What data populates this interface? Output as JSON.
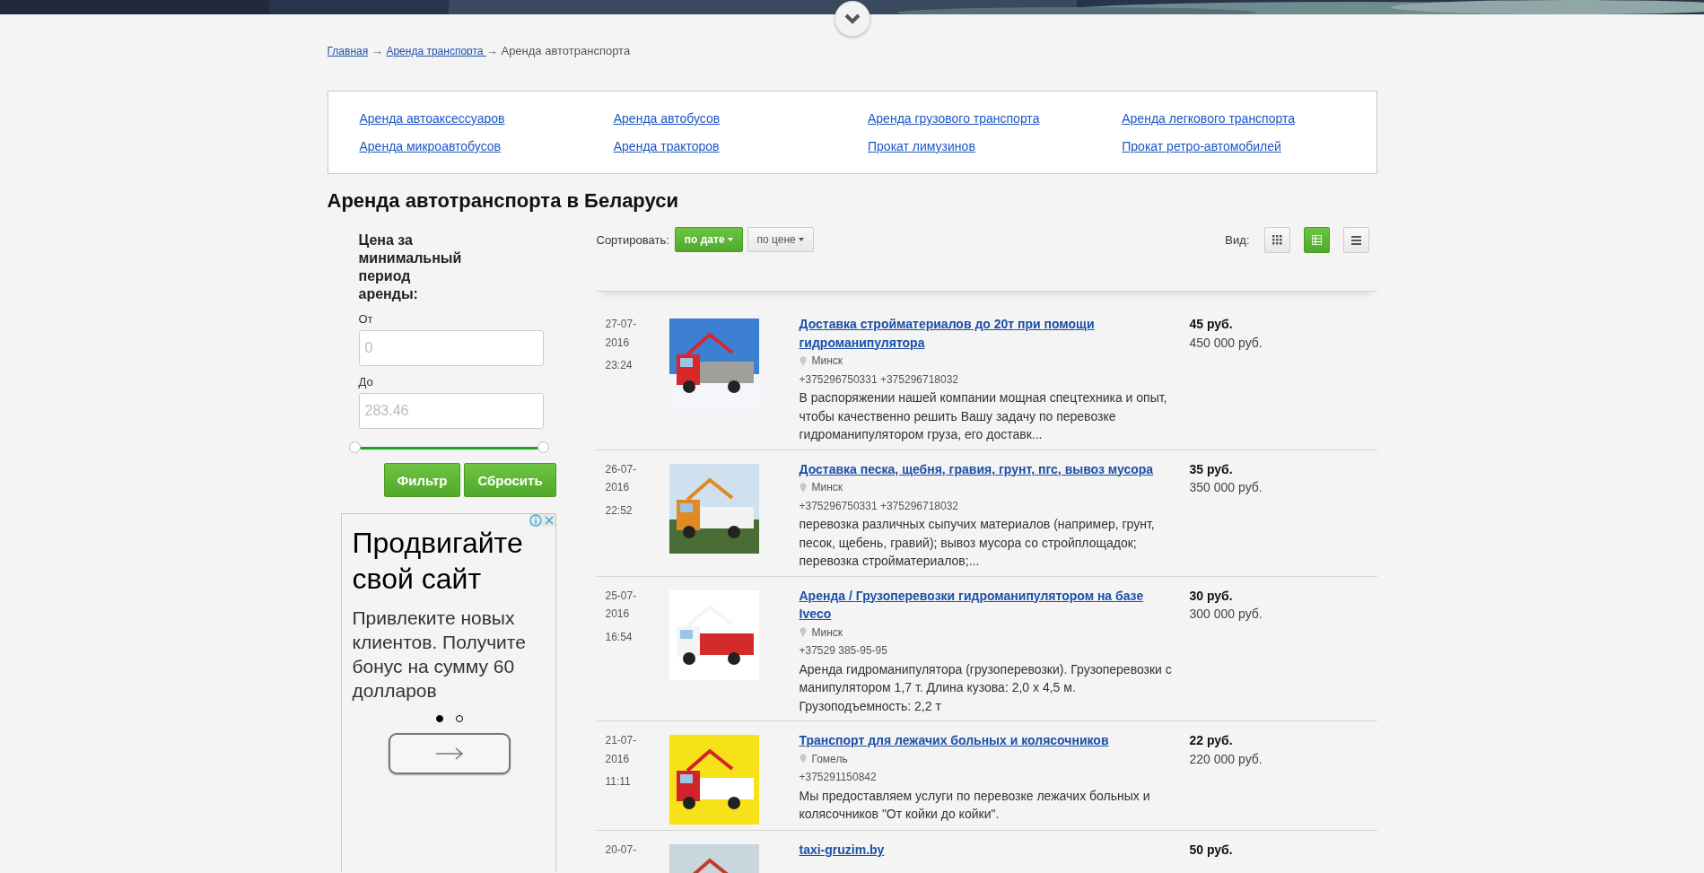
{
  "breadcrumb": [
    {
      "label": "Главная",
      "link": true
    },
    {
      "label": "Аренда транспорта ",
      "link": true
    },
    {
      "label": "Аренда автотранспорта",
      "link": false
    }
  ],
  "breadcrumb_separator": "→",
  "categories": [
    "Аренда автоаксессуаров",
    "Аренда автобусов",
    "Аренда грузового транспорта",
    "Аренда легкового транспорта",
    "Аренда микроавтобусов",
    "Аренда тракторов",
    "Прокат лимузинов",
    "Прокат ретро-автомобилей"
  ],
  "heading": "Аренда автотранспорта в Беларуси",
  "filter": {
    "title": "Цена за минимальный период аренды:",
    "from_label": "От",
    "from_placeholder": "0",
    "to_label": "До",
    "to_placeholder": "283.46",
    "slider": {
      "level": 1
    },
    "buttons": [
      "Фильтр",
      "Сбросить"
    ]
  },
  "ad": {
    "headline": "Продвигайте свой сайт",
    "body": "Привлеките новых клиентов. Получите бонус на сумму 60 долларов",
    "dots": [
      {
        "selected": true
      },
      {
        "selected": false
      }
    ]
  },
  "sort": {
    "label": "Сортировать:",
    "options": [
      {
        "label": "по дате",
        "selected": true
      },
      {
        "label": "по цене",
        "selected": false
      }
    ]
  },
  "view": {
    "label": "Вид:",
    "options": [
      {
        "kind": "grid",
        "selected": false
      },
      {
        "kind": "table",
        "selected": true
      },
      {
        "kind": "list",
        "selected": false
      }
    ]
  },
  "listings": [
    {
      "date": "27-07-2016",
      "time": "23:24",
      "title": "Доставка стройматериалов до 20т при помощи гидроманипулятора",
      "city": "Минск",
      "phone": "+375296750331 +375296718032",
      "description": "В распоряжении нашей компании мощная спецтехника и опыт, чтобы качественно решить Вашу задачу по перевозке гидроманипулятором груза, его доставк...",
      "price": "45 руб.",
      "price_old": "450 000 руб."
    },
    {
      "date": "26-07-2016",
      "time": "22:52",
      "title": "Доставка песка, щебня, гравия, грунт, пгс, вывоз мусора",
      "city": "Минск",
      "phone": "+375296750331 +375296718032",
      "description": "перевозка различных сыпучих материалов (например, грунт, песок, щебень, гравий); вывоз мусора со стройплощадок; перевозка стройматериалов;...",
      "price": "35 руб.",
      "price_old": "350 000 руб."
    },
    {
      "date": "25-07-2016",
      "time": "16:54",
      "title": "Аренда / Грузоперевозки гидроманипулятором на базе Iveco",
      "city": "Минск",
      "phone": "+37529 385-95-95",
      "description": "Аренда гидроманипулятора (грузоперевозки). Грузоперевозки с манипулятором 1,7 т. Длина кузова: 2,0 х 4,5 м. Грузоподъемность: 2,2 т",
      "price": "30 руб.",
      "price_old": "300 000 руб."
    },
    {
      "date": "21-07-2016",
      "time": "11:11",
      "title": "Транспорт для лежачих больных и колясочников",
      "city": "Гомель",
      "phone": "+375291150842",
      "description": "Мы предоставляем услуги по перевозке лежачих больных и колясочников \"От койки до койки\".",
      "price": "22 руб.",
      "price_old": "220 000 руб."
    },
    {
      "date": "20-07-",
      "title": "taxi-gruzim.by",
      "price": "50 руб."
    }
  ]
}
